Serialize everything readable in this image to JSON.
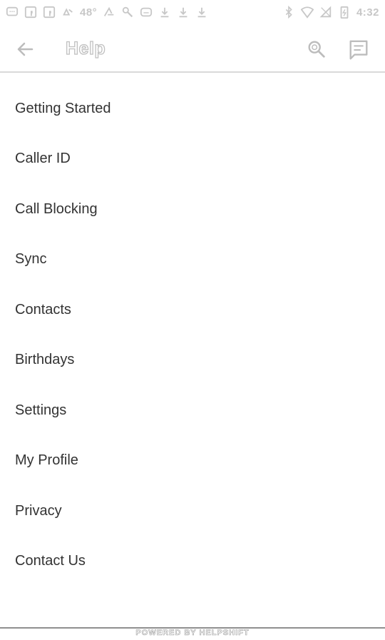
{
  "status_bar": {
    "left_icons": [
      "chat-bubble-icon",
      "facebook-icon",
      "facebook-icon",
      "recycle-icon",
      "temperature-icon",
      "flash-icon",
      "wrench-icon",
      "voicemail-icon",
      "download-icon",
      "download-icon",
      "download-icon"
    ],
    "temperature": "48°",
    "right_icons": [
      "bluetooth-icon",
      "wifi-icon",
      "no-signal-icon",
      "battery-icon"
    ],
    "time": "4:32"
  },
  "toolbar": {
    "title": "Help",
    "back_icon": "back-arrow-icon",
    "search_icon": "search-icon",
    "chat_icon": "chat-icon"
  },
  "help_items": [
    {
      "label": "Getting Started"
    },
    {
      "label": "Caller ID"
    },
    {
      "label": "Call Blocking"
    },
    {
      "label": "Sync"
    },
    {
      "label": "Contacts"
    },
    {
      "label": "Birthdays"
    },
    {
      "label": "Settings"
    },
    {
      "label": "My Profile"
    },
    {
      "label": "Privacy"
    },
    {
      "label": "Contact Us"
    }
  ],
  "footer": {
    "text": "POWERED BY HELPSHIFT"
  },
  "colors": {
    "text": "#333333",
    "icons": "#bcbcbc",
    "divider": "#d9d9d9"
  }
}
